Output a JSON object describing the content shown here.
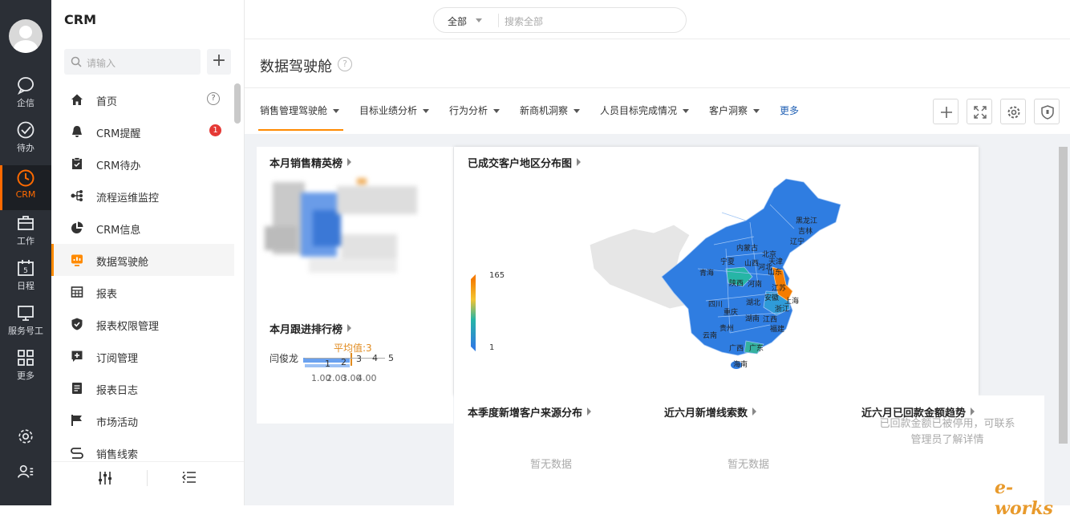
{
  "rail": {
    "items": [
      {
        "label": "企信",
        "icon": "chat-icon"
      },
      {
        "label": "待办",
        "icon": "check-circle-icon"
      },
      {
        "label": "CRM",
        "icon": "clock-icon"
      },
      {
        "label": "工作",
        "icon": "briefcase-icon"
      },
      {
        "label": "日程",
        "icon": "calendar-icon"
      },
      {
        "label": "服务号工",
        "icon": "monitor-icon"
      },
      {
        "label": "更多",
        "icon": "grid-icon"
      }
    ],
    "active": "CRM",
    "accent": "#ff6a00"
  },
  "sidebar": {
    "title": "CRM",
    "search_placeholder": "请输入",
    "add_label": "+",
    "items": [
      {
        "label": "首页",
        "icon": "home-icon"
      },
      {
        "label": "CRM提醒",
        "icon": "bell-icon",
        "badge": "1"
      },
      {
        "label": "CRM待办",
        "icon": "clipboard-icon"
      },
      {
        "label": "流程运维监控",
        "icon": "flow-icon"
      },
      {
        "label": "CRM信息",
        "icon": "pie-icon"
      },
      {
        "label": "数据驾驶舱",
        "icon": "dashboard-icon"
      },
      {
        "label": "报表",
        "icon": "table-icon"
      },
      {
        "label": "报表权限管理",
        "icon": "shield-icon"
      },
      {
        "label": "订阅管理",
        "icon": "subscribe-icon"
      },
      {
        "label": "报表日志",
        "icon": "log-icon"
      },
      {
        "label": "市场活动",
        "icon": "flag-icon"
      },
      {
        "label": "销售线索",
        "icon": "lead-icon"
      }
    ],
    "active": "数据驾驶舱",
    "help_mark": "?"
  },
  "topbar": {
    "scope": "全部",
    "search_placeholder": "搜索全部"
  },
  "page": {
    "title": "数据驾驶舱",
    "help_mark": "?"
  },
  "tabs": [
    {
      "label": "销售管理驾驶舱"
    },
    {
      "label": "目标业绩分析"
    },
    {
      "label": "行为分析"
    },
    {
      "label": "新商机洞察"
    },
    {
      "label": "人员目标完成情况"
    },
    {
      "label": "客户洞察"
    }
  ],
  "tabs_more": "更多",
  "cards": {
    "sales_top": {
      "title": "本月销售精英榜"
    },
    "follow_rank": {
      "title": "本月跟进排行榜",
      "person": "闫俊龙",
      "avg_label": "平均值:3",
      "top_ticks": [
        "1",
        "2",
        "3",
        "4",
        "5"
      ],
      "bottom_ticks": [
        "1.00",
        "2.00",
        "3.00",
        "4.00"
      ]
    },
    "map": {
      "title": "已成交客户地区分布图",
      "legend_max": "165",
      "legend_min": "1",
      "provinces": [
        "黑龙江",
        "吉林",
        "辽宁",
        "内蒙古",
        "北京",
        "天津",
        "河北",
        "山西",
        "山东",
        "宁夏",
        "青海",
        "陕西",
        "河南",
        "江苏",
        "安徽",
        "上海",
        "四川",
        "湖北",
        "浙江",
        "重庆",
        "湖南",
        "江西",
        "贵州",
        "福建",
        "云南",
        "广西",
        "广东",
        "海南"
      ]
    },
    "source": {
      "title": "本季度新增客户来源分布",
      "empty": "暂无数据"
    },
    "clues": {
      "title": "近六月新增线索数",
      "empty": "暂无数据"
    },
    "payback": {
      "title": "近六月已回款金额趋势",
      "note_line1": "已回款金额已被停用，可联系",
      "note_line2": "管理员了解详情"
    }
  },
  "watermark": "e-works"
}
